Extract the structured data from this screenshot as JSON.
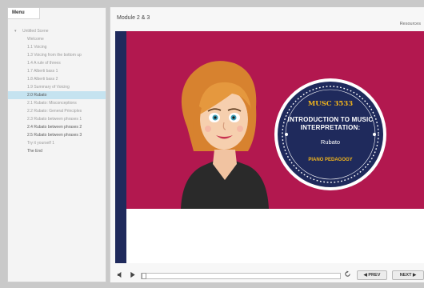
{
  "sidebar": {
    "tab_label": "Menu",
    "items": [
      {
        "label": "Untitled Scene",
        "state": "root"
      },
      {
        "label": "Welcome",
        "state": "normal"
      },
      {
        "label": "1.1 Voicing",
        "state": "normal"
      },
      {
        "label": "1.3 Voicing from the bottom up",
        "state": "normal"
      },
      {
        "label": "1.4 A rule of threes",
        "state": "normal"
      },
      {
        "label": "1.7 Alberti bass 1",
        "state": "normal"
      },
      {
        "label": "1.8 Alberti bass 2",
        "state": "normal"
      },
      {
        "label": "1.9 Summary of Voicing",
        "state": "normal"
      },
      {
        "label": "2.0 Rubato",
        "state": "active"
      },
      {
        "label": "2.1 Rubato: Misconceptions",
        "state": "normal"
      },
      {
        "label": "2.2 Rubato: General Principles",
        "state": "normal"
      },
      {
        "label": "2.3 Rubato between phrases 1",
        "state": "normal"
      },
      {
        "label": "2.4 Rubato between phrases 2",
        "state": "visited"
      },
      {
        "label": "2.5 Rubato between phrases 3",
        "state": "visited"
      },
      {
        "label": "Try it yourself 1",
        "state": "normal"
      },
      {
        "label": "The End",
        "state": "visited"
      }
    ]
  },
  "header": {
    "module_title": "Module 2 & 3",
    "resources_label": "Resources"
  },
  "slide": {
    "course_code": "MUSC 3533",
    "title": "Introduction to Music Interpretation:",
    "subtitle": "Rubato",
    "program": "PIANO PEDAGOGY",
    "colors": {
      "background": "#b2184f",
      "badge": "#1f2a5c",
      "accent": "#f2b51b"
    }
  },
  "controls": {
    "prev_label": "◀ PREV",
    "next_label": "NEXT ▶",
    "volume_icon": "speaker-icon",
    "play_icon": "play-icon",
    "replay_icon": "replay-icon",
    "progress_fraction": 0.0
  }
}
